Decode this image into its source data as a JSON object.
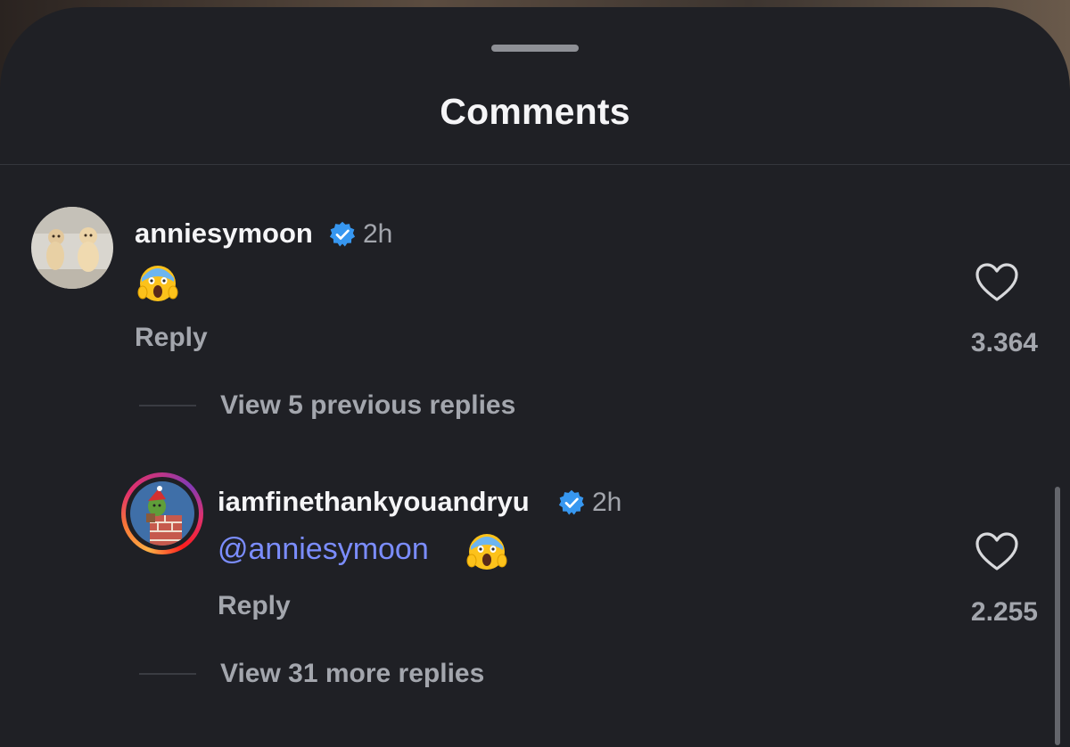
{
  "sheet": {
    "title": "Comments"
  },
  "comments": [
    {
      "username": "anniesymoon",
      "verified": true,
      "time": "2h",
      "body_emoji": "face-screaming-in-fear",
      "reply_label": "Reply",
      "likes": "3.364",
      "view_replies": "View 5 previous replies"
    },
    {
      "username": "iamfinethankyouandryu",
      "verified": true,
      "time": "2h",
      "mention": "@anniesymoon",
      "body_emoji": "face-screaming-in-fear",
      "reply_label": "Reply",
      "likes": "2.255",
      "view_replies": "View 31 more replies"
    }
  ],
  "icons": {
    "heart": "heart-outline-icon",
    "verified": "verified-badge-icon"
  },
  "colors": {
    "background": "#1f2025",
    "text_primary": "#f5f5f7",
    "text_secondary": "#a3a6ad",
    "mention": "#7b8dff",
    "verified": "#3797f0"
  }
}
